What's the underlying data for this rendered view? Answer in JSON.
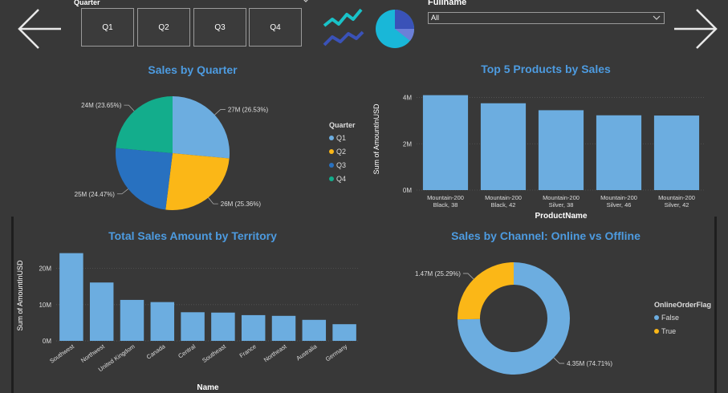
{
  "header": {
    "quarter_slicer": {
      "title": "Quarter",
      "options": [
        "Q1",
        "Q2",
        "Q3",
        "Q4"
      ]
    },
    "fullname_slicer": {
      "title": "Fullname",
      "selected": "All"
    },
    "icons": [
      "back-arrow-icon",
      "line-chart-icon",
      "pie-chart-icon",
      "chevron-down-icon",
      "forward-arrow-icon"
    ]
  },
  "colors": {
    "background": "#383838",
    "title": "#4d9be0",
    "bar": "#6cade0",
    "q1": "#6cade0",
    "q2": "#fbb717",
    "q3": "#2871c0",
    "q4": "#13ad8c",
    "false": "#6cade0",
    "true": "#fbb717"
  },
  "chart_data": [
    {
      "type": "pie",
      "title": "Sales by Quarter",
      "legend_title": "Quarter",
      "legend_position": "right",
      "slices": [
        {
          "label": "Q1",
          "value": 27,
          "data_label": "27M (26.53%)",
          "color": "#6cade0"
        },
        {
          "label": "Q2",
          "value": 26,
          "data_label": "26M (25.36%)",
          "color": "#fbb717"
        },
        {
          "label": "Q3",
          "value": 25,
          "data_label": "25M (24.47%)",
          "color": "#2871c0"
        },
        {
          "label": "Q4",
          "value": 24,
          "data_label": "24M (23.65%)",
          "color": "#13ad8c"
        }
      ]
    },
    {
      "type": "bar",
      "title": "Top 5 Products by Sales",
      "xlabel": "ProductName",
      "ylabel": "Sum of AmountInUSD",
      "categories": [
        [
          "Mountain-200",
          "Black, 38"
        ],
        [
          "Mountain-200",
          "Black, 42"
        ],
        [
          "Mountain-200",
          "Silver, 38"
        ],
        [
          "Mountain-200",
          "Silver, 46"
        ],
        [
          "Mountain-200",
          "Silver, 42"
        ]
      ],
      "values": [
        4.1,
        3.75,
        3.45,
        3.23,
        3.22
      ],
      "ylim": [
        0,
        4.4
      ],
      "ticks": [
        {
          "v": 0,
          "label": "0M"
        },
        {
          "v": 2,
          "label": "2M"
        },
        {
          "v": 4,
          "label": "4M"
        }
      ],
      "grid": true
    },
    {
      "type": "bar",
      "title": "Total Sales Amount by Territory",
      "xlabel": "Name",
      "ylabel": "Sum of AmountInUSD",
      "categories": [
        "Southwest",
        "Northwest",
        "United Kingdom",
        "Canada",
        "Central",
        "Southeast",
        "France",
        "Northeast",
        "Australia",
        "Germany"
      ],
      "values": [
        24.2,
        16.1,
        11.3,
        10.7,
        7.9,
        7.8,
        7.1,
        6.9,
        5.8,
        4.6
      ],
      "ylim": [
        0,
        25
      ],
      "ticks": [
        {
          "v": 0,
          "label": "0M"
        },
        {
          "v": 10,
          "label": "10M"
        },
        {
          "v": 20,
          "label": "20M"
        }
      ],
      "grid": true
    },
    {
      "type": "pie",
      "title": "Sales by Channel: Online vs Offline",
      "donut": true,
      "legend_title": "OnlineOrderFlag",
      "legend_position": "right",
      "slices": [
        {
          "label": "False",
          "value": 74.71,
          "data_label": "4.35M (74.71%)",
          "color": "#6cade0"
        },
        {
          "label": "True",
          "value": 25.29,
          "data_label": "1.47M (25.29%)",
          "color": "#fbb717"
        }
      ]
    }
  ]
}
